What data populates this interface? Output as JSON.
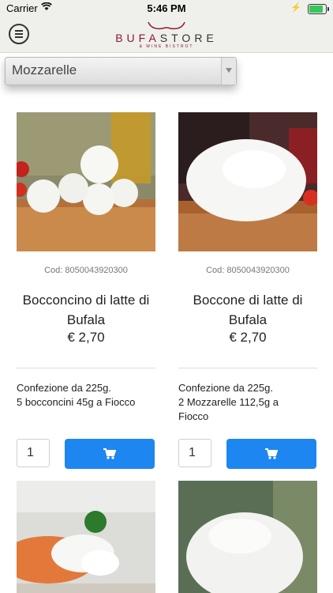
{
  "status_bar": {
    "carrier": "Carrier",
    "time": "5:46 PM"
  },
  "header": {
    "logo_name_prefix": "BUFA",
    "logo_name_suffix": "STORE",
    "logo_tagline": "& WINE BISTROT"
  },
  "category_select": {
    "selected": "Mozzarelle"
  },
  "products": [
    {
      "code": "Cod: 8050043920300",
      "title": "Bocconcino di latte di Bufala",
      "price": "€ 2,70",
      "desc_lines": [
        "Confezione da 225g.",
        "5 bocconcini 45g a Fiocco"
      ],
      "quantity": "1"
    },
    {
      "code": "Cod: 8050043920300",
      "title": "Boccone di latte di Bufala",
      "price": "€ 2,70",
      "desc_lines": [
        "Confezione da 225g.",
        "2 Mozzarelle 112,5g a",
        "Fiocco"
      ],
      "quantity": "1"
    }
  ],
  "colors": {
    "accent": "#1e86f0",
    "brand": "#8b1a2b",
    "bar_bg": "#efefeb"
  }
}
